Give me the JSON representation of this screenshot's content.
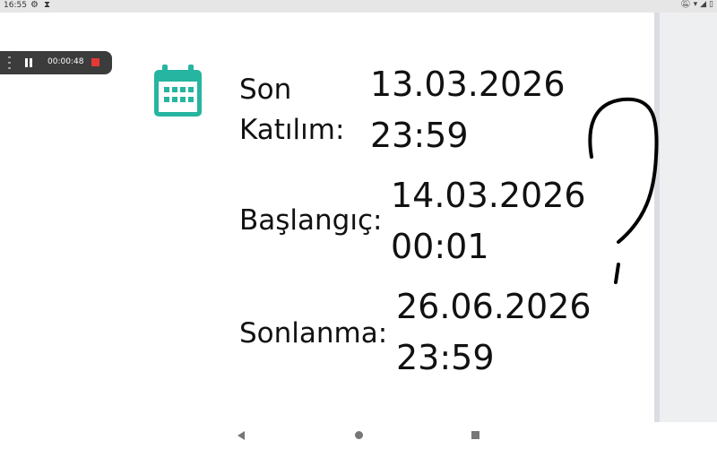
{
  "status_bar": {
    "time": "16:55",
    "left_icons": [
      "gear-icon",
      "hourglass-icon"
    ],
    "right_icons": [
      "mute-icon",
      "wifi-icon",
      "signal-icon",
      "battery-icon"
    ]
  },
  "recorder": {
    "elapsed": "00:00:48",
    "stop_color": "#e53935"
  },
  "event": {
    "icon": "calendar-icon",
    "icon_color": "#26b5a0",
    "deadline": {
      "label_line1": "Son",
      "label_line2": "Katılım:",
      "date": "13.03.2026",
      "time": "23:59"
    },
    "start": {
      "label": "Başlangıç:",
      "date": "14.03.2026",
      "time": "00:01"
    },
    "end": {
      "label": "Sonlanma:",
      "date": "26.06.2026",
      "time": "23:59"
    }
  },
  "annotation": {
    "symbol": "?"
  },
  "nav_bar": {
    "buttons": [
      "back-icon",
      "home-icon",
      "recents-icon"
    ]
  }
}
